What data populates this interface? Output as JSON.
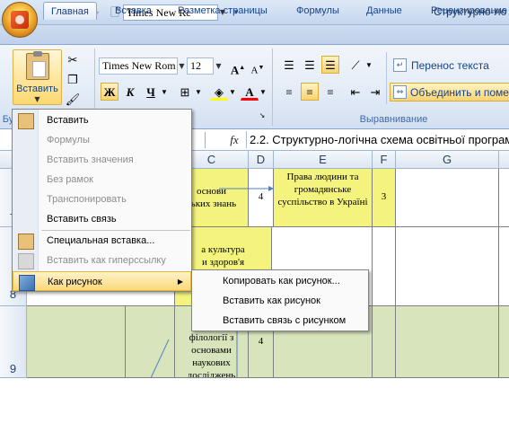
{
  "titlebar": {
    "font_name": "Times New Rc",
    "window_title": "Структурно-ло"
  },
  "tabs": [
    "Главная",
    "Вставка",
    "Разметка страницы",
    "Формулы",
    "Данные",
    "Рецензирование"
  ],
  "ribbon": {
    "paste_label": "Вставить",
    "clipboard_group_short": "Бу",
    "font_name": "Times New Rom",
    "font_size": "12",
    "bold": "Ж",
    "italic": "К",
    "underline": "Ч",
    "wrap_text": "Перенос текста",
    "merge_center": "Объединить и поме",
    "alignment_group": "Выравнивание"
  },
  "formula_bar": {
    "fx": "fx",
    "content": "2.2. Структурно-логічна схема освітньої програми"
  },
  "columns": [
    "C",
    "D",
    "E",
    "F",
    "G"
  ],
  "rows": [
    "7",
    "8",
    "9"
  ],
  "cells": {
    "c7": "основи\nських знань",
    "d7": "4",
    "e7": "Права людини та громадянське суспільство в Україні",
    "f7": "3",
    "c8": "а культура\nи здоров'я",
    "c9": "Вс\nгерм\nфілології з основами наукових досліджень",
    "d9": "4"
  },
  "paste_menu": {
    "items": [
      {
        "label": "Вставить",
        "enabled": true
      },
      {
        "label": "Формулы",
        "enabled": false
      },
      {
        "label": "Вставить значения",
        "enabled": false
      },
      {
        "label": "Без рамок",
        "enabled": false
      },
      {
        "label": "Транспонировать",
        "enabled": false
      },
      {
        "label": "Вставить связь",
        "enabled": true
      },
      {
        "label": "Специальная вставка...",
        "enabled": true
      },
      {
        "label": "Вставить как гиперссылку",
        "enabled": false
      },
      {
        "label": "Как рисунок",
        "enabled": true
      }
    ]
  },
  "picture_submenu": {
    "items": [
      "Копировать как рисунок...",
      "Вставить как рисунок",
      "Вставить связь с рисунком"
    ]
  },
  "colors": {
    "yellow_cell": "#f3f37d",
    "green_cell": "#d8e4bc",
    "menu_highlight": "#fbd97a"
  }
}
